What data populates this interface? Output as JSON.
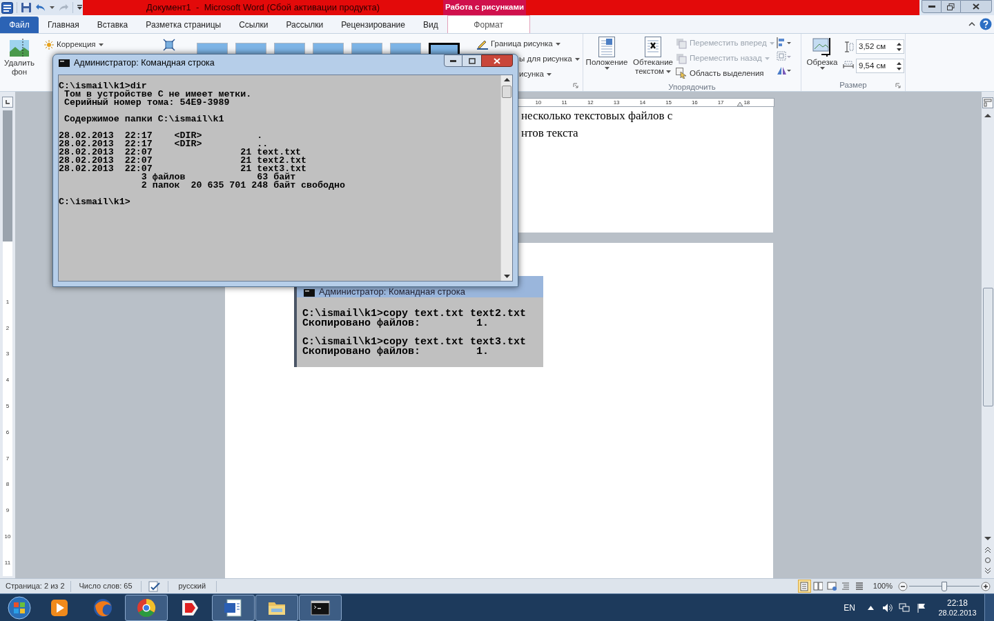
{
  "title_bar": {
    "title": "Документ1  -  Microsoft Word (Сбой активации продукта)",
    "context_label": "Работа с рисунками"
  },
  "tabs": [
    {
      "label": "Файл",
      "kind": "file",
      "selected": false
    },
    {
      "label": "Главная",
      "kind": "tab",
      "selected": false
    },
    {
      "label": "Вставка",
      "kind": "tab",
      "selected": false
    },
    {
      "label": "Разметка страницы",
      "kind": "tab",
      "selected": false
    },
    {
      "label": "Ссылки",
      "kind": "tab",
      "selected": false
    },
    {
      "label": "Рассылки",
      "kind": "tab",
      "selected": false
    },
    {
      "label": "Рецензирование",
      "kind": "tab",
      "selected": false
    },
    {
      "label": "Вид",
      "kind": "tab",
      "selected": false
    },
    {
      "label": "Формат",
      "kind": "contextual",
      "selected": true
    }
  ],
  "ribbon": {
    "remove_background": [
      "Удалить",
      "фон"
    ],
    "correction": "Коррекция",
    "style_thumbnails": [
      {
        "selected": false
      },
      {
        "selected": false
      },
      {
        "selected": false
      },
      {
        "selected": false
      },
      {
        "selected": false
      },
      {
        "selected": false
      },
      {
        "selected": true
      }
    ],
    "picture_border": "Граница рисунка",
    "row_2": "ы для рисунка",
    "row_3": "исунка",
    "arrange": {
      "position": "Положение",
      "wrap": [
        "Обтекание",
        "текстом"
      ],
      "commands": [
        {
          "label": "Переместить вперед",
          "disabled": true,
          "dropdown": true
        },
        {
          "label": "Переместить назад",
          "disabled": true,
          "dropdown": true
        },
        {
          "label": "Область выделения",
          "disabled": false,
          "dropdown": false
        }
      ],
      "group_label": "Упорядочить"
    },
    "size": {
      "crop": "Обрезка",
      "height": "3,52 см",
      "width": "9,54 см",
      "group_label": "Размер"
    }
  },
  "ruler": {
    "numbers": [
      "10",
      "11",
      "12",
      "13",
      "14",
      "15",
      "16",
      "17",
      "18"
    ]
  },
  "vertical_ruler": {
    "numbers": [
      "1",
      "2",
      "3",
      "4",
      "5",
      "6",
      "7",
      "8",
      "9",
      "10",
      "11"
    ]
  },
  "document": {
    "page_1_lines": [
      "несколько текстовых файлов с",
      "нтов текста"
    ],
    "embedded_console": {
      "title": "Администратор: Командная строка",
      "blocks": [
        [
          "C:\\ismail\\k1>copy text.txt text2.txt",
          "Скопировано файлов:         1."
        ],
        [
          "C:\\ismail\\k1>copy text.txt text3.txt",
          "Скопировано файлов:         1."
        ]
      ]
    }
  },
  "console_window": {
    "title": "Администратор: Командная строка",
    "blocks": [
      [
        "C:\\ismail\\k1>dir",
        " Том в устройстве C не имеет метки.",
        " Серийный номер тома: 54E9-3989"
      ],
      [
        " Содержимое папки C:\\ismail\\k1"
      ],
      [
        "28.02.2013  22:17    <DIR>          .",
        "28.02.2013  22:17    <DIR>          ..",
        "28.02.2013  22:07                21 text.txt",
        "28.02.2013  22:07                21 text2.txt",
        "28.02.2013  22:07                21 text3.txt",
        "               3 файлов             63 байт",
        "               2 папок  20 635 701 248 байт свободно"
      ],
      [
        "C:\\ismail\\k1>"
      ]
    ]
  },
  "status_bar": {
    "page": "Страница: 2 из 2",
    "words": "Число слов: 65",
    "language": "русский",
    "views": [
      {
        "selected": true
      },
      {
        "selected": false
      },
      {
        "selected": false
      },
      {
        "selected": false
      },
      {
        "selected": false
      }
    ],
    "zoom": "100%",
    "zoom_slider": {
      "level": 0.5
    }
  },
  "taskbar": {
    "apps": [
      {
        "kind": "media",
        "running": false
      },
      {
        "kind": "globe",
        "running": false
      },
      {
        "kind": "browser",
        "running": true
      },
      {
        "kind": "tag",
        "running": false
      },
      {
        "kind": "document",
        "running": true
      },
      {
        "kind": "folder",
        "running": true
      },
      {
        "kind": "terminal",
        "running": true
      }
    ],
    "language": "EN",
    "time": "22:18",
    "date": "28.02.2013"
  }
}
